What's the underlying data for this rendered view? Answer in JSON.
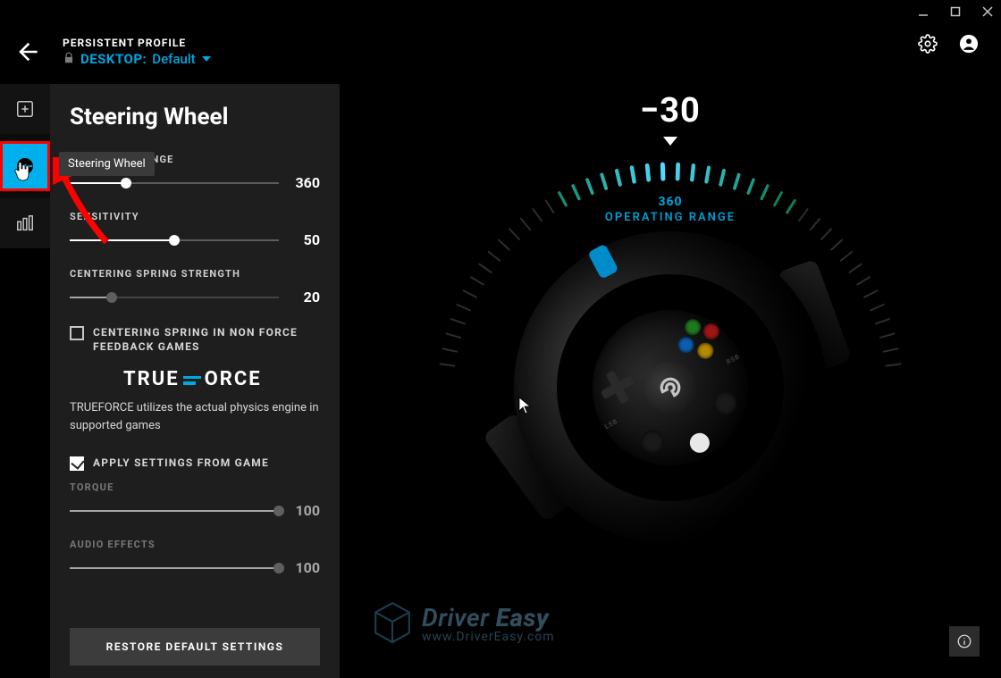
{
  "window": {
    "profile_label": "PERSISTENT PROFILE",
    "profile_scope": "DESKTOP:",
    "profile_name": "Default"
  },
  "sidebar": {
    "tooltip": "Steering Wheel"
  },
  "panel": {
    "title": "Steering Wheel",
    "settings": {
      "operating_range": {
        "label": "OPERATING RANGE",
        "value": "360",
        "pct": 27
      },
      "sensitivity": {
        "label": "SENSITIVITY",
        "value": "50",
        "pct": 50
      },
      "centering": {
        "label": "CENTERING SPRING STRENGTH",
        "value": "20",
        "pct": 20
      },
      "torque": {
        "label": "TORQUE",
        "value": "100",
        "pct": 100
      },
      "audio": {
        "label": "AUDIO EFFECTS",
        "value": "100",
        "pct": 100
      }
    },
    "checkboxes": {
      "centering_spring_nonffb": {
        "label": "CENTERING SPRING IN NON FORCE FEEDBACK GAMES",
        "checked": false
      },
      "apply_from_game": {
        "label": "APPLY SETTINGS FROM GAME",
        "checked": true
      }
    },
    "trueforce": {
      "logo_pre": "TRUE",
      "logo_post": "ORCE",
      "desc": "TRUEFORCE utilizes the actual physics engine in supported games"
    },
    "restore": "RESTORE DEFAULT SETTINGS"
  },
  "viz": {
    "angle_reading": "−30",
    "range_value": "360",
    "range_label": "OPERATING RANGE"
  },
  "watermark": {
    "brand_light": "Driver",
    "brand_bold": "Easy",
    "url": "www.DriverEasy.com"
  }
}
